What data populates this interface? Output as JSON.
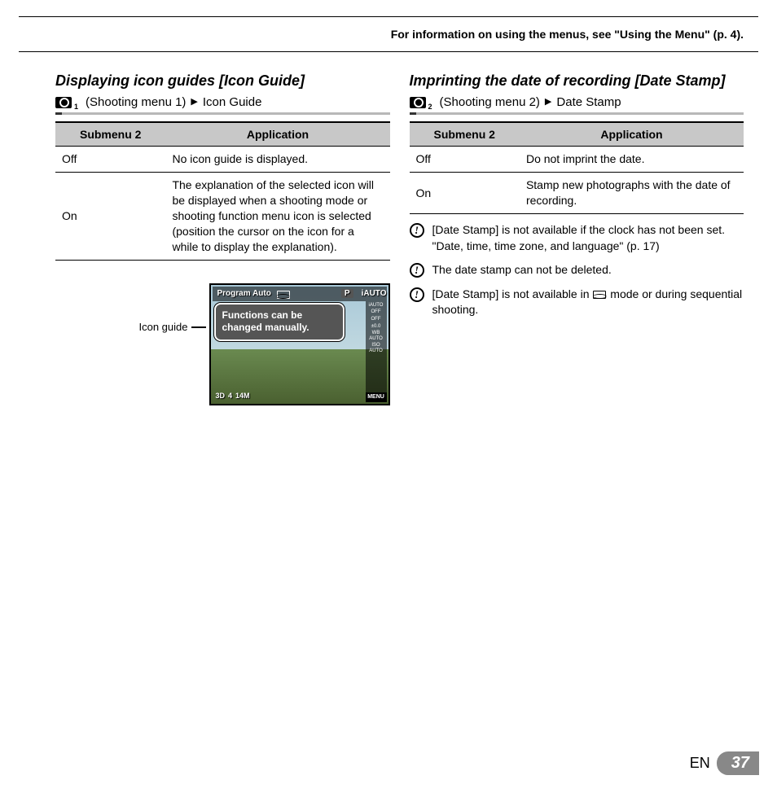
{
  "header": {
    "text": "For information on using the menus, see \"Using the Menu\" (p. 4)."
  },
  "left": {
    "title": "Displaying icon guides [Icon Guide]",
    "breadcrumb": {
      "cam_sub": "1",
      "menu": "(Shooting menu 1)",
      "item": "Icon Guide"
    },
    "table": {
      "h1": "Submenu 2",
      "h2": "Application",
      "r1c1": "Off",
      "r1c2": "No icon guide is displayed.",
      "r2c1": "On",
      "r2c2": "The explanation of the selected icon will be displayed when a shooting mode or shooting function menu icon is selected (position the cursor on the icon for a while to display the explanation)."
    },
    "figure": {
      "label": "Icon guide",
      "top_mode": "Program Auto",
      "top_p": "P",
      "top_iauto": "iAUTO",
      "tooltip": "Functions can be changed manually.",
      "side": {
        "a": "iAUTO",
        "b": "OFF",
        "c": "OFF",
        "d": "±0.0",
        "e": "WB AUTO",
        "f": "ISO AUTO"
      },
      "bottom": {
        "a": "3D",
        "b": "4",
        "c": "14M"
      },
      "menu": "MENU"
    }
  },
  "right": {
    "title": "Imprinting the date of recording [Date Stamp]",
    "breadcrumb": {
      "cam_sub": "2",
      "menu": "(Shooting menu 2)",
      "item": "Date Stamp"
    },
    "table": {
      "h1": "Submenu 2",
      "h2": "Application",
      "r1c1": "Off",
      "r1c2": "Do not imprint the date.",
      "r2c1": "On",
      "r2c2": "Stamp new photographs with the date of recording."
    },
    "notes": {
      "n1a": "[Date Stamp] is not available if the clock has not been set.",
      "n1b": "\"Date, time, time zone, and language\" (p. 17)",
      "n2": "The date stamp can not be deleted.",
      "n3a": "[Date Stamp] is not available in ",
      "n3b": " mode or during sequential shooting."
    }
  },
  "footer": {
    "lang": "EN",
    "page": "37"
  }
}
